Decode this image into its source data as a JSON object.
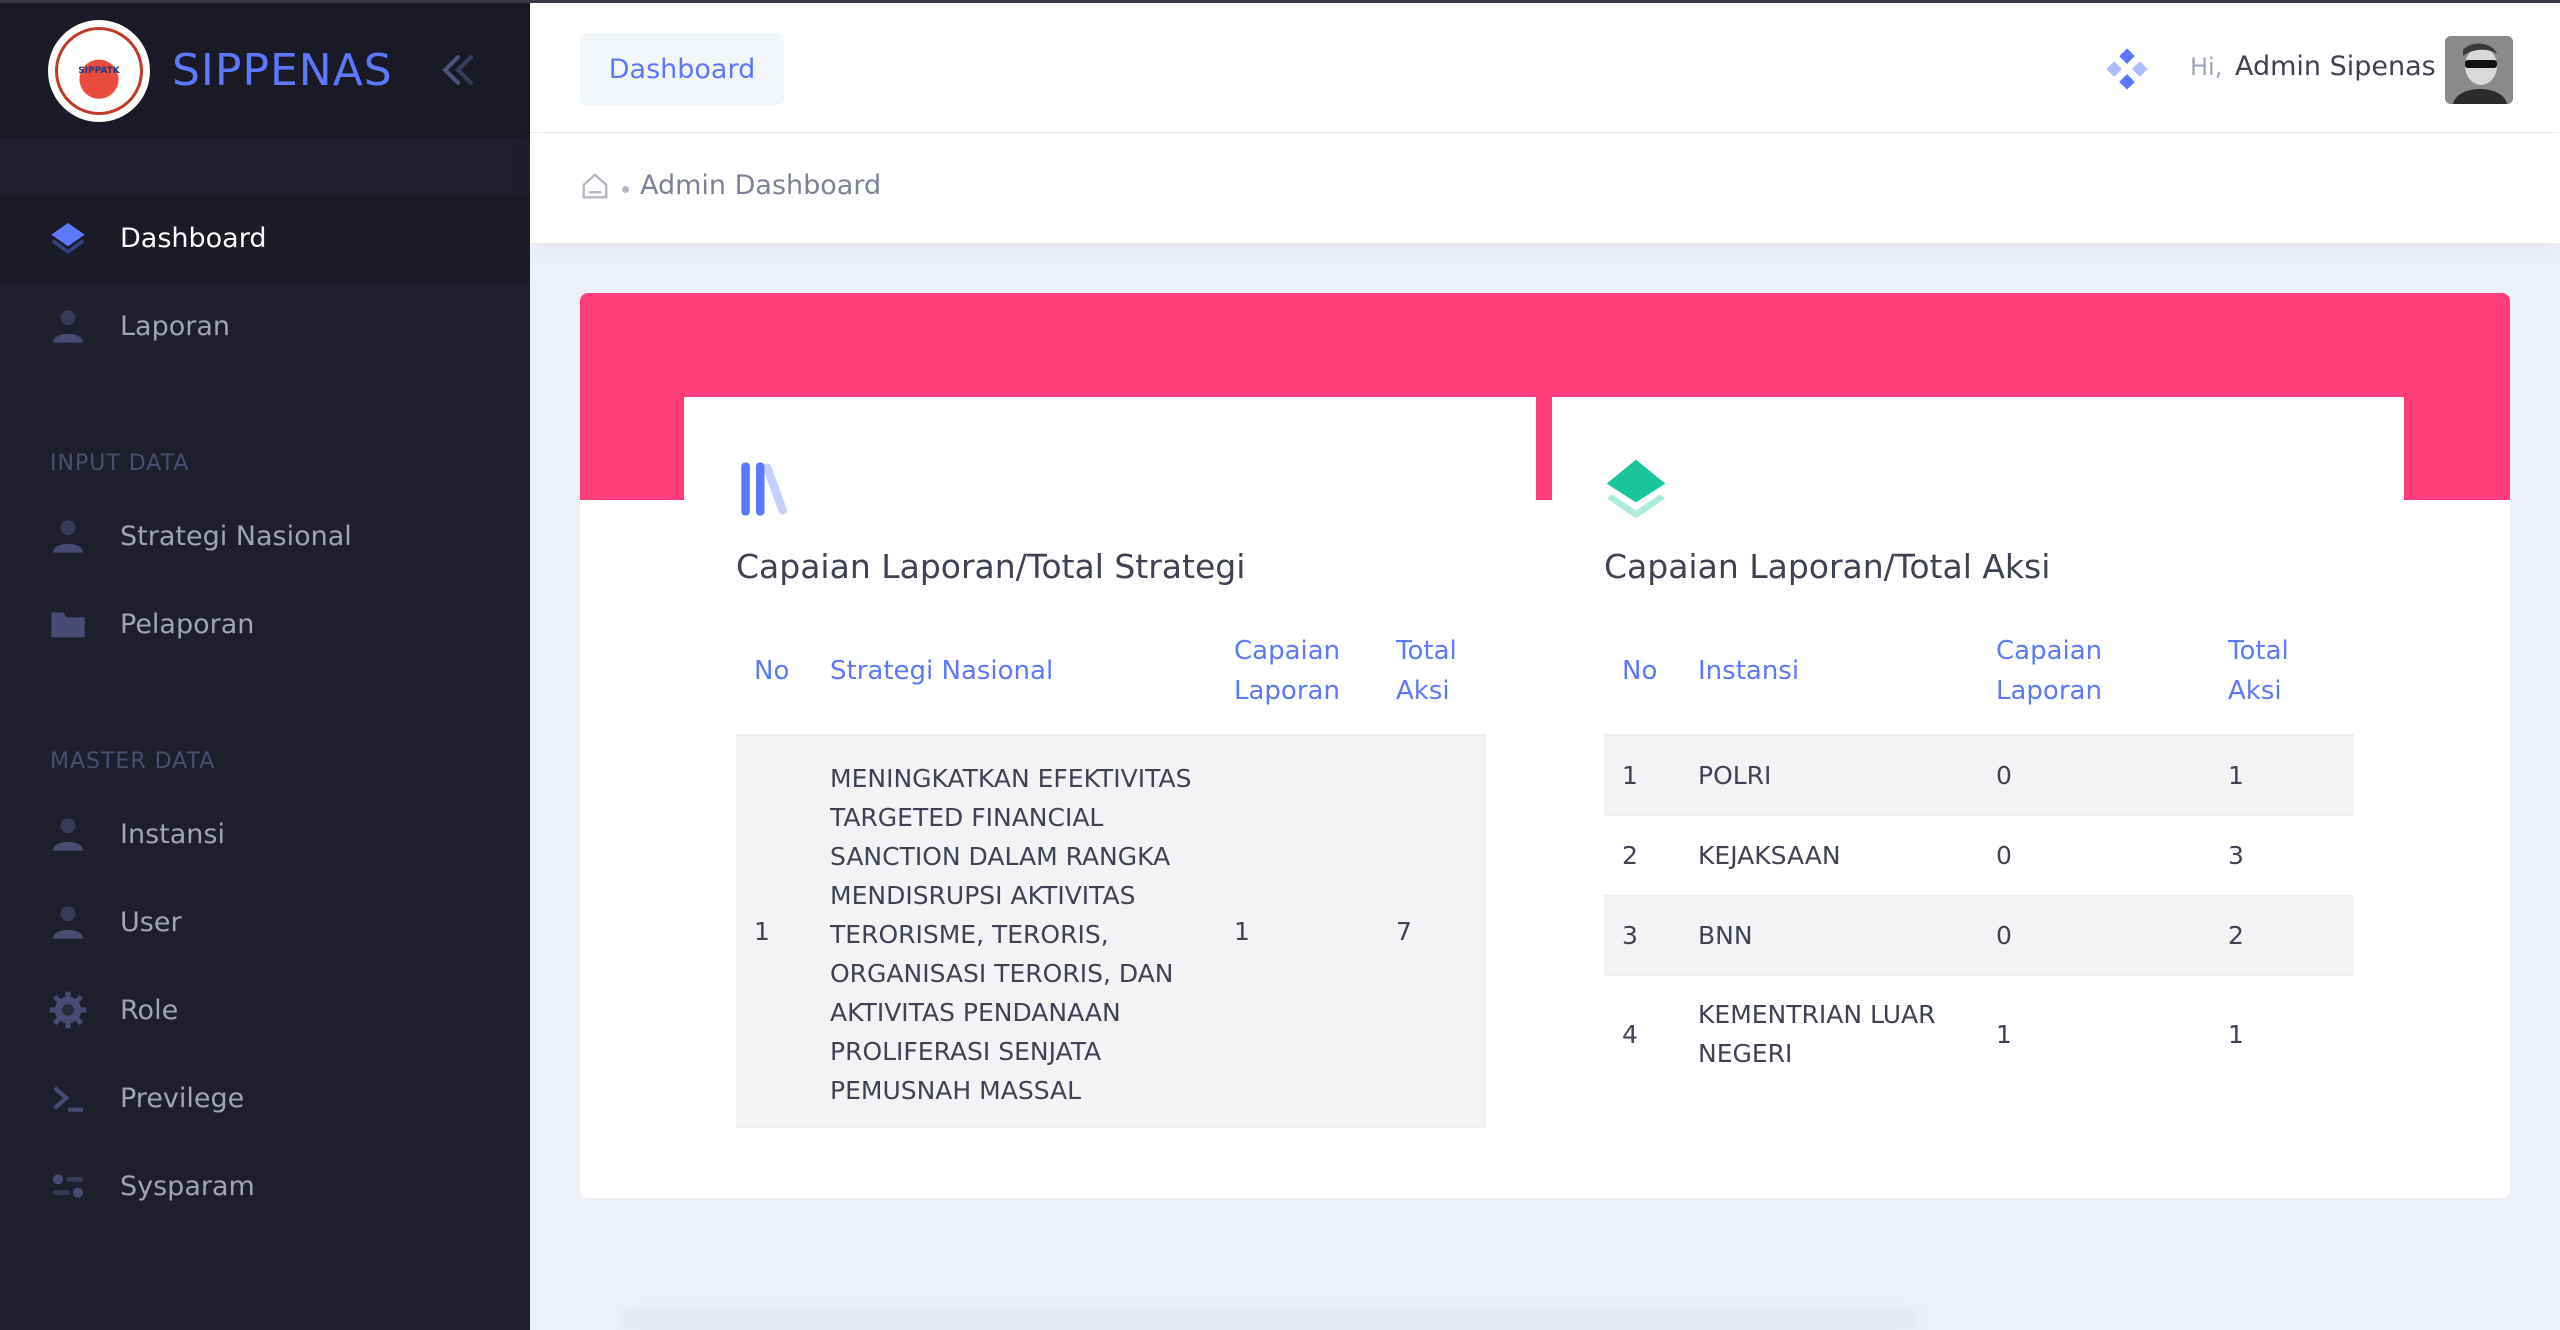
{
  "brand": {
    "name": "SIPPENAS",
    "logo_text": "SIPPATK"
  },
  "sidebar": {
    "top_items": [
      {
        "label": "Dashboard",
        "icon": "layers-icon",
        "active": true
      },
      {
        "label": "Laporan",
        "icon": "user-icon"
      }
    ],
    "sections": [
      {
        "title": "INPUT DATA",
        "items": [
          {
            "label": "Strategi Nasional",
            "icon": "user-icon"
          },
          {
            "label": "Pelaporan",
            "icon": "folder-icon"
          }
        ]
      },
      {
        "title": "MASTER DATA",
        "items": [
          {
            "label": "Instansi",
            "icon": "user-icon"
          },
          {
            "label": "User",
            "icon": "user-icon"
          },
          {
            "label": "Role",
            "icon": "gear-icon"
          },
          {
            "label": "Previlege",
            "icon": "terminal-icon"
          },
          {
            "label": "Sysparam",
            "icon": "toggle-icon"
          }
        ]
      }
    ]
  },
  "header": {
    "tab_label": "Dashboard",
    "greeting": "Hi,",
    "user_name": "Admin Sipenas"
  },
  "breadcrumb": {
    "current": "Admin Dashboard"
  },
  "colors": {
    "accent": "#5d78ff",
    "pink": "#ff3d7a",
    "green": "#1bc5bd",
    "sidebar_bg": "#1e1e2d"
  },
  "strategy_card": {
    "title": "Capaian Laporan/Total Strategi",
    "headers": {
      "no": "No",
      "name": "Strategi Nasional",
      "capaian_1": "Capaian",
      "capaian_2": "Laporan",
      "total_1": "Total",
      "total_2": "Aksi"
    },
    "rows": [
      {
        "no": "1",
        "name": "MENINGKATKAN EFEKTIVITAS TARGETED FINANCIAL SANCTION DALAM RANGKA MENDISRUPSI AKTIVITAS TERORISME, TERORIS, ORGANISASI TERORIS, DAN AKTIVITAS PENDANAAN PROLIFERASI SENJATA PEMUSNAH MASSAL",
        "capaian": "1",
        "total": "7"
      }
    ]
  },
  "aksi_card": {
    "title": "Capaian Laporan/Total Aksi",
    "headers": {
      "no": "No",
      "name": "Instansi",
      "capaian_1": "Capaian",
      "capaian_2": "Laporan",
      "total_1": "Total",
      "total_2": "Aksi"
    },
    "rows": [
      {
        "no": "1",
        "name": "POLRI",
        "capaian": "0",
        "total": "1"
      },
      {
        "no": "2",
        "name": "KEJAKSAAN",
        "capaian": "0",
        "total": "3"
      },
      {
        "no": "3",
        "name": "BNN",
        "capaian": "0",
        "total": "2"
      },
      {
        "no": "4",
        "name": "KEMENTRIAN LUAR NEGERI",
        "capaian": "1",
        "total": "1"
      }
    ]
  }
}
